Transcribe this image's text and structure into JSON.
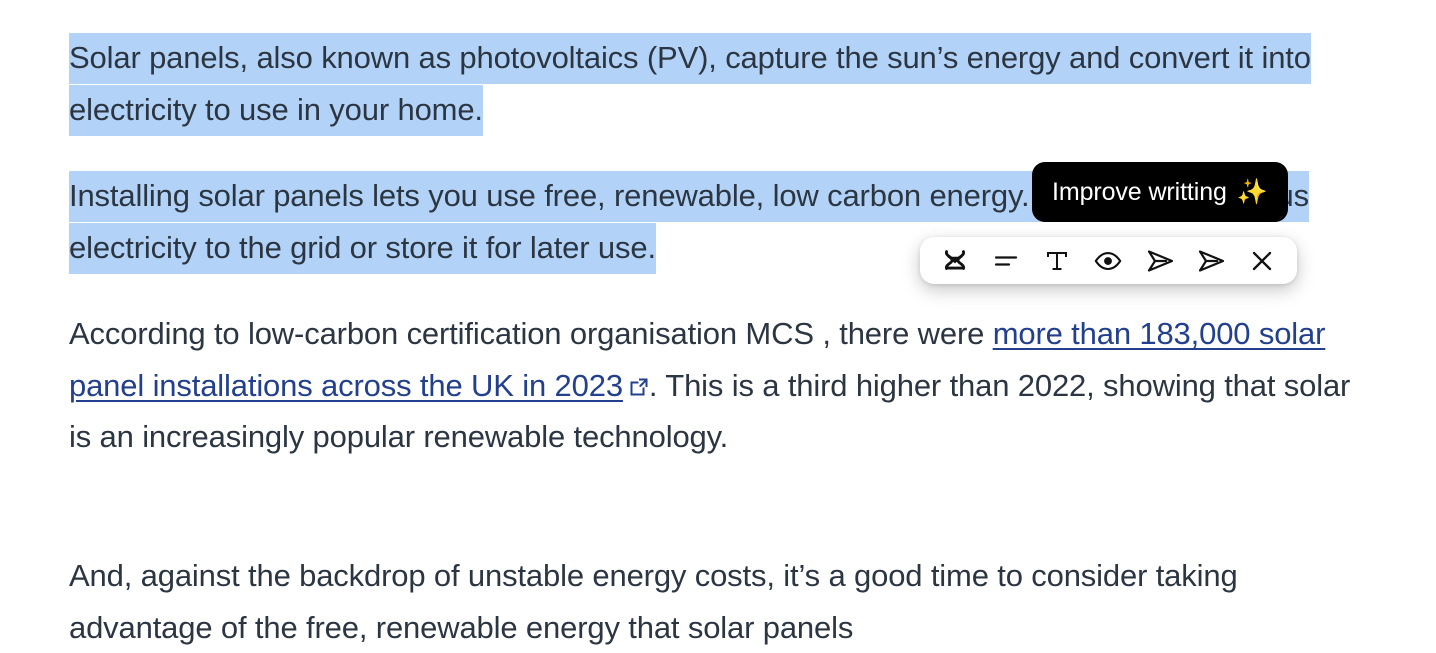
{
  "document": {
    "paragraphs": [
      {
        "id": "p1",
        "selected": true,
        "text": "Solar panels, also known as photovoltaics (PV), capture the sun’s energy and convert it into electricity to use in your home."
      },
      {
        "id": "p2",
        "selected": true,
        "text": "Installing solar panels lets you use free, renewable, low carbon energy. You can sell surplus electricity to the grid or store it for later use."
      },
      {
        "id": "p3",
        "selected": false,
        "lead": "According to low-carbon certification organisation MCS , there were ",
        "link_text": "more than 183,000 solar panel installations across the UK in 2023",
        "link_icon": "external-link-icon",
        "tail": ". This is a third higher than 2022, showing that solar is an increasingly popular renewable technology."
      },
      {
        "id": "p4",
        "selected": false,
        "text": "And, against the backdrop of unstable energy costs, it’s a good time to consider taking advantage of the free, renewable energy that solar panels"
      }
    ],
    "selection_color": "#b2d3f7",
    "text_color": "#2c3642",
    "link_color": "#23408e"
  },
  "tooltip": {
    "label": "Improve writting",
    "sparkle": "✨",
    "background": "#000000",
    "text_color": "#ffffff"
  },
  "toolbar": {
    "background": "#ffffff",
    "icon_color": "#111111",
    "buttons": [
      {
        "name": "improve-writing-icon",
        "label": "Improve writting"
      },
      {
        "name": "summarize-icon",
        "label": "Summarize"
      },
      {
        "name": "text-format-icon",
        "label": "Text"
      },
      {
        "name": "eye-icon",
        "label": "Preview"
      },
      {
        "name": "send-icon",
        "label": "Send"
      },
      {
        "name": "send-alt-icon",
        "label": "Send"
      },
      {
        "name": "close-icon",
        "label": "Close"
      }
    ]
  }
}
